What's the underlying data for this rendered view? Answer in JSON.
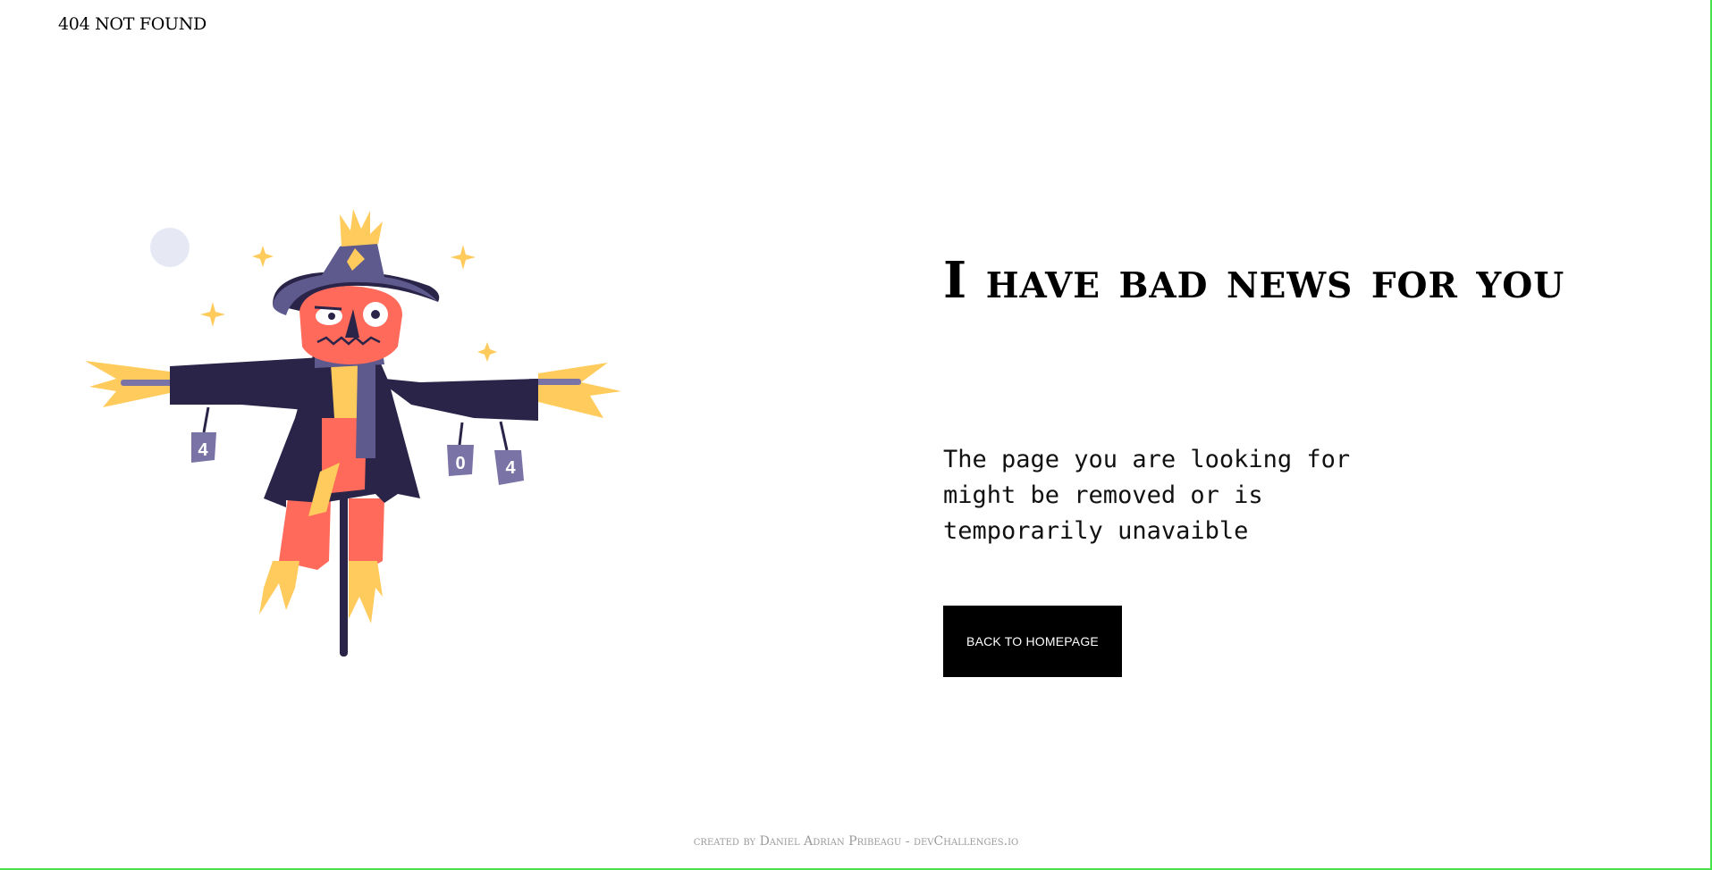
{
  "header": {
    "brand": "404 NOT FOUND"
  },
  "main": {
    "headline": "I have bad news for you",
    "subtext": "The page you are looking for might be removed or is temporarily unavaible",
    "cta_label": "BACK TO HOMEPAGE"
  },
  "illustration": {
    "can_labels": [
      "4",
      "0",
      "4"
    ]
  },
  "footer": {
    "credit": "created by Daniel Adrian Pribeagu - devChallenges.io"
  },
  "colors": {
    "hat": "#5f5a8e",
    "coat": "#2a2449",
    "face": "#ff6a5a",
    "straw": "#ffcb5c",
    "can": "#7a74a6",
    "moon": "#e6e9f4",
    "frame": "#4ae24a"
  }
}
